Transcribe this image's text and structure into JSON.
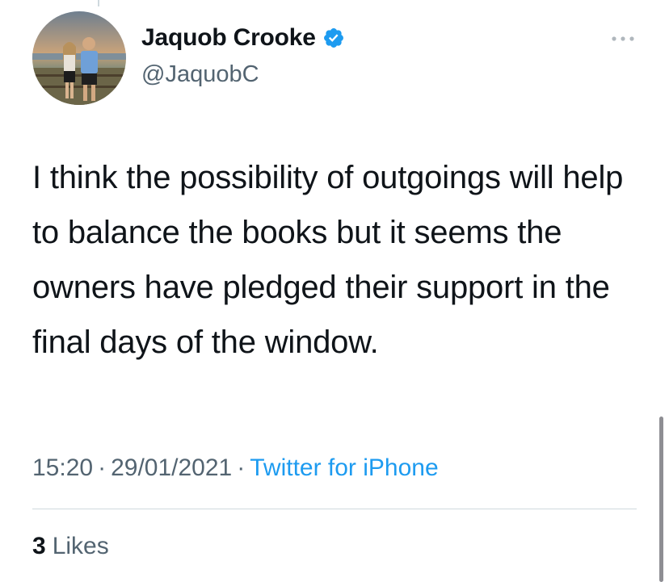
{
  "tweet": {
    "author": {
      "display_name": "Jaquob Crooke",
      "handle": "@JaquobC",
      "verified": true,
      "avatar_icon": "profile-photo"
    },
    "text": "I think the possibility of outgoings will help to balance the books but it seems the owners have pledged their support in the final days of the window.",
    "time": "15:20",
    "separator": "·",
    "date": "29/01/2021",
    "source": "Twitter for iPhone",
    "likes": {
      "count": "3",
      "label": "Likes"
    },
    "more_icon": "more-horizontal-icon"
  },
  "colors": {
    "text_primary": "#0f1419",
    "text_secondary": "#536471",
    "accent": "#1d9bf0",
    "divider": "#cfd9de"
  }
}
